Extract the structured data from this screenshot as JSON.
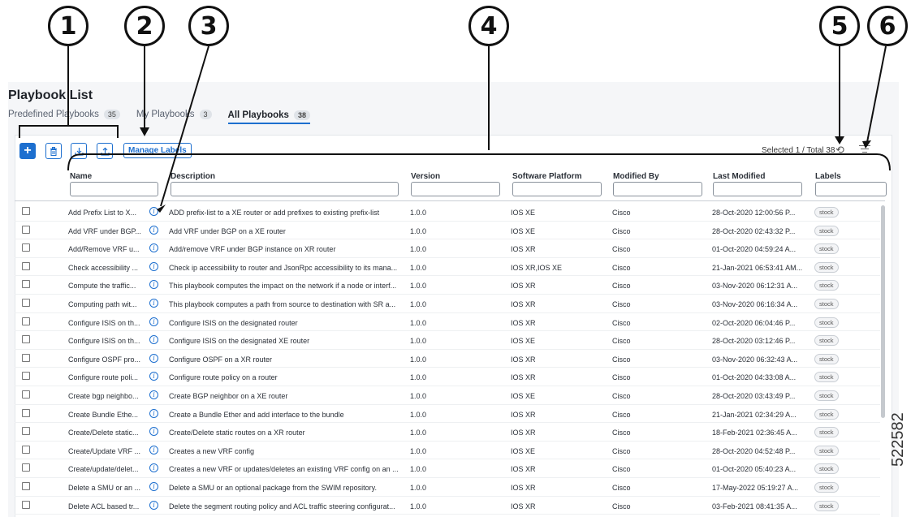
{
  "callouts": [
    "1",
    "2",
    "3",
    "4",
    "5",
    "6"
  ],
  "page_title": "Playbook List",
  "tabs": [
    {
      "label": "Predefined Playbooks",
      "count": "35"
    },
    {
      "label": "My Playbooks",
      "count": "3"
    },
    {
      "label": "All Playbooks",
      "count": "38"
    }
  ],
  "toolbar": {
    "add_icon": "plus-icon",
    "delete_icon": "trash-icon",
    "import_icon": "download-icon",
    "export_icon": "upload-icon",
    "manage_labels": "Manage Labels",
    "selection": "Selected 1 / Total 38",
    "refresh_icon": "refresh-icon",
    "filter_icon": "filter-icon"
  },
  "columns": {
    "name": "Name",
    "description": "Description",
    "version": "Version",
    "platform": "Software Platform",
    "modified_by": "Modified By",
    "last_modified": "Last Modified",
    "labels": "Labels"
  },
  "rows": [
    {
      "name": "Add Prefix List to X...",
      "desc": "ADD prefix-list to a XE router or add prefixes to existing prefix-list",
      "ver": "1.0.0",
      "plat": "IOS XE",
      "mod": "Cisco",
      "last": "28-Oct-2020 12:00:56 P...",
      "label": "stock"
    },
    {
      "name": "Add VRF under BGP...",
      "desc": "Add VRF under BGP on a XE router",
      "ver": "1.0.0",
      "plat": "IOS XE",
      "mod": "Cisco",
      "last": "28-Oct-2020 02:43:32 P...",
      "label": "stock"
    },
    {
      "name": "Add/Remove VRF u...",
      "desc": "Add/remove VRF under BGP instance on XR router",
      "ver": "1.0.0",
      "plat": "IOS XR",
      "mod": "Cisco",
      "last": "01-Oct-2020 04:59:24 A...",
      "label": "stock"
    },
    {
      "name": "Check accessibility ...",
      "desc": "Check ip accessibility to router and JsonRpc accessibility to its mana...",
      "ver": "1.0.0",
      "plat": "IOS XR,IOS XE",
      "mod": "Cisco",
      "last": "21-Jan-2021 06:53:41 AM...",
      "label": "stock"
    },
    {
      "name": "Compute the traffic...",
      "desc": "This playbook computes the impact on the network if a node or interf...",
      "ver": "1.0.0",
      "plat": "IOS XR",
      "mod": "Cisco",
      "last": "03-Nov-2020 06:12:31 A...",
      "label": "stock"
    },
    {
      "name": "Computing path wit...",
      "desc": "This playbook computes a path from source to destination with SR a...",
      "ver": "1.0.0",
      "plat": "IOS XR",
      "mod": "Cisco",
      "last": "03-Nov-2020 06:16:34 A...",
      "label": "stock"
    },
    {
      "name": "Configure ISIS on th...",
      "desc": "Configure ISIS on the designated router",
      "ver": "1.0.0",
      "plat": "IOS XR",
      "mod": "Cisco",
      "last": "02-Oct-2020 06:04:46 P...",
      "label": "stock"
    },
    {
      "name": "Configure ISIS on th...",
      "desc": "Configure ISIS on the designated XE router",
      "ver": "1.0.0",
      "plat": "IOS XE",
      "mod": "Cisco",
      "last": "28-Oct-2020 03:12:46 P...",
      "label": "stock"
    },
    {
      "name": "Configure OSPF pro...",
      "desc": "Configure OSPF on a XR router",
      "ver": "1.0.0",
      "plat": "IOS XR",
      "mod": "Cisco",
      "last": "03-Nov-2020 06:32:43 A...",
      "label": "stock"
    },
    {
      "name": "Configure route poli...",
      "desc": "Configure route policy on a router",
      "ver": "1.0.0",
      "plat": "IOS XR",
      "mod": "Cisco",
      "last": "01-Oct-2020 04:33:08 A...",
      "label": "stock"
    },
    {
      "name": "Create bgp neighbo...",
      "desc": "Create BGP neighbor on a XE router",
      "ver": "1.0.0",
      "plat": "IOS XE",
      "mod": "Cisco",
      "last": "28-Oct-2020 03:43:49 P...",
      "label": "stock"
    },
    {
      "name": "Create Bundle Ethe...",
      "desc": "Create a Bundle Ether and add interface to the bundle",
      "ver": "1.0.0",
      "plat": "IOS XR",
      "mod": "Cisco",
      "last": "21-Jan-2021 02:34:29 A...",
      "label": "stock"
    },
    {
      "name": "Create/Delete static...",
      "desc": "Create/Delete static routes on a XR router",
      "ver": "1.0.0",
      "plat": "IOS XR",
      "mod": "Cisco",
      "last": "18-Feb-2021 02:36:45 A...",
      "label": "stock"
    },
    {
      "name": "Create/Update VRF ...",
      "desc": "Creates a new VRF config",
      "ver": "1.0.0",
      "plat": "IOS XE",
      "mod": "Cisco",
      "last": "28-Oct-2020 04:52:48 P...",
      "label": "stock"
    },
    {
      "name": "Create/update/delet...",
      "desc": "Creates a new VRF or updates/deletes an existing VRF config on an ...",
      "ver": "1.0.0",
      "plat": "IOS XR",
      "mod": "Cisco",
      "last": "01-Oct-2020 05:40:23 A...",
      "label": "stock"
    },
    {
      "name": "Delete a SMU or an ...",
      "desc": "Delete a SMU or an optional package from the SWIM repository.",
      "ver": "1.0.0",
      "plat": "IOS XR",
      "mod": "Cisco",
      "last": "17-May-2022 05:19:27 A...",
      "label": "stock"
    },
    {
      "name": "Delete ACL based tr...",
      "desc": "Delete the segment routing policy and ACL traffic steering configurat...",
      "ver": "1.0.0",
      "plat": "IOS XR",
      "mod": "Cisco",
      "last": "03-Feb-2021 08:41:35 A...",
      "label": "stock"
    }
  ],
  "figure_id": "522582"
}
